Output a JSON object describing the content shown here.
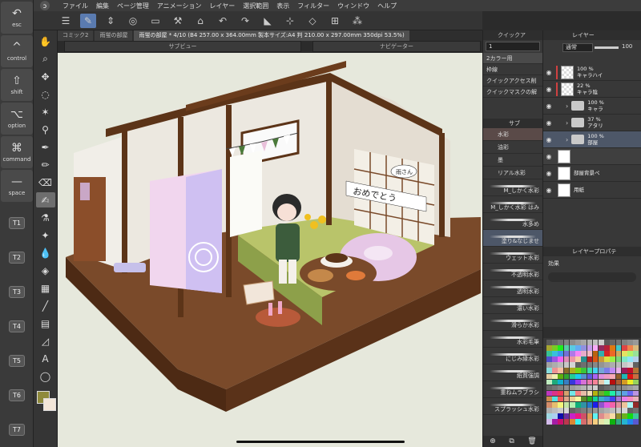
{
  "modifiers": [
    {
      "glyph": "↶",
      "label": "esc"
    },
    {
      "glyph": "^",
      "label": "control"
    },
    {
      "glyph": "⇧",
      "label": "shift"
    },
    {
      "glyph": "⌥",
      "label": "option"
    },
    {
      "glyph": "⌘",
      "label": "command"
    },
    {
      "glyph": "—",
      "label": "space"
    }
  ],
  "tkeys": [
    "T1",
    "T2",
    "T3",
    "T4",
    "T5",
    "T6",
    "T7"
  ],
  "menu": [
    "ファイル",
    "編集",
    "ページ管理",
    "アニメーション",
    "レイヤー",
    "選択範囲",
    "表示",
    "フィルター",
    "ウィンドウ",
    "ヘルプ"
  ],
  "tabs": [
    {
      "label": "コミック2",
      "active": false
    },
    {
      "label": "雨蛍の部屋",
      "active": false
    },
    {
      "label": "雨蛍の部屋 * 4/10 (B4 257.00 x 364.00mm 製本サイズ:A4 判 210.00 x 297.00mm 350dpi 53.5%)",
      "active": true
    }
  ],
  "subview_label": "サブビュー",
  "navigator_label": "ナビゲーター",
  "quick_access": {
    "title": "クイックア",
    "input_value": "1",
    "set_name": "2カラー用",
    "rows": [
      "枠線",
      "クイックアクセス削",
      "クイックマスクの解"
    ]
  },
  "subtool": {
    "title": "サブ",
    "groups": [
      {
        "label": "水彩",
        "selected": true
      },
      {
        "label": "油彩",
        "selected": false
      },
      {
        "label": "墨",
        "selected": false
      },
      {
        "label": "リアル水彩",
        "selected": false
      }
    ],
    "brushes": [
      "M_しかく水彩",
      "M_しかく水彩 はみ",
      "水多め",
      "塗り&なじませ",
      "ウェット水彩",
      "不透明水彩",
      "透明水彩",
      "濃い水彩",
      "滑らか水彩",
      "水彩毛筆",
      "にじみ縁水彩",
      "紙質強調",
      "重ねムラブラシ",
      "スプラッシュ水彩"
    ],
    "selected_brush": "塗り&なじませ"
  },
  "layer": {
    "title": "レイヤー",
    "blend_mode": "通常",
    "opacity": "100",
    "rows": [
      {
        "pct": "100 %",
        "mode": "通",
        "name": "キャラハイ",
        "type": "raster",
        "visible": true
      },
      {
        "pct": "22 %",
        "mode": "通",
        "name": "キャラ陰",
        "type": "raster",
        "visible": true
      },
      {
        "pct": "100 %",
        "mode": "",
        "name": "キャラ",
        "type": "folder",
        "visible": true
      },
      {
        "pct": "37 %",
        "mode": "",
        "name": "アタリ",
        "type": "folder",
        "visible": true
      },
      {
        "pct": "100 %",
        "mode": "",
        "name": "部屋",
        "type": "folder",
        "visible": true
      },
      {
        "pct": "",
        "mode": "",
        "name": "",
        "type": "mask",
        "visible": true
      },
      {
        "pct": "",
        "mode": "",
        "name": "部屋背景ペ",
        "type": "paper",
        "visible": true
      },
      {
        "pct": "",
        "mode": "",
        "name": "用紙",
        "type": "paper",
        "visible": true
      }
    ]
  },
  "layer_property": {
    "title": "レイヤープロパテ",
    "effect_label": "効果"
  },
  "canvas_text": {
    "banner": "おめでとう",
    "speech": "雨さん"
  }
}
